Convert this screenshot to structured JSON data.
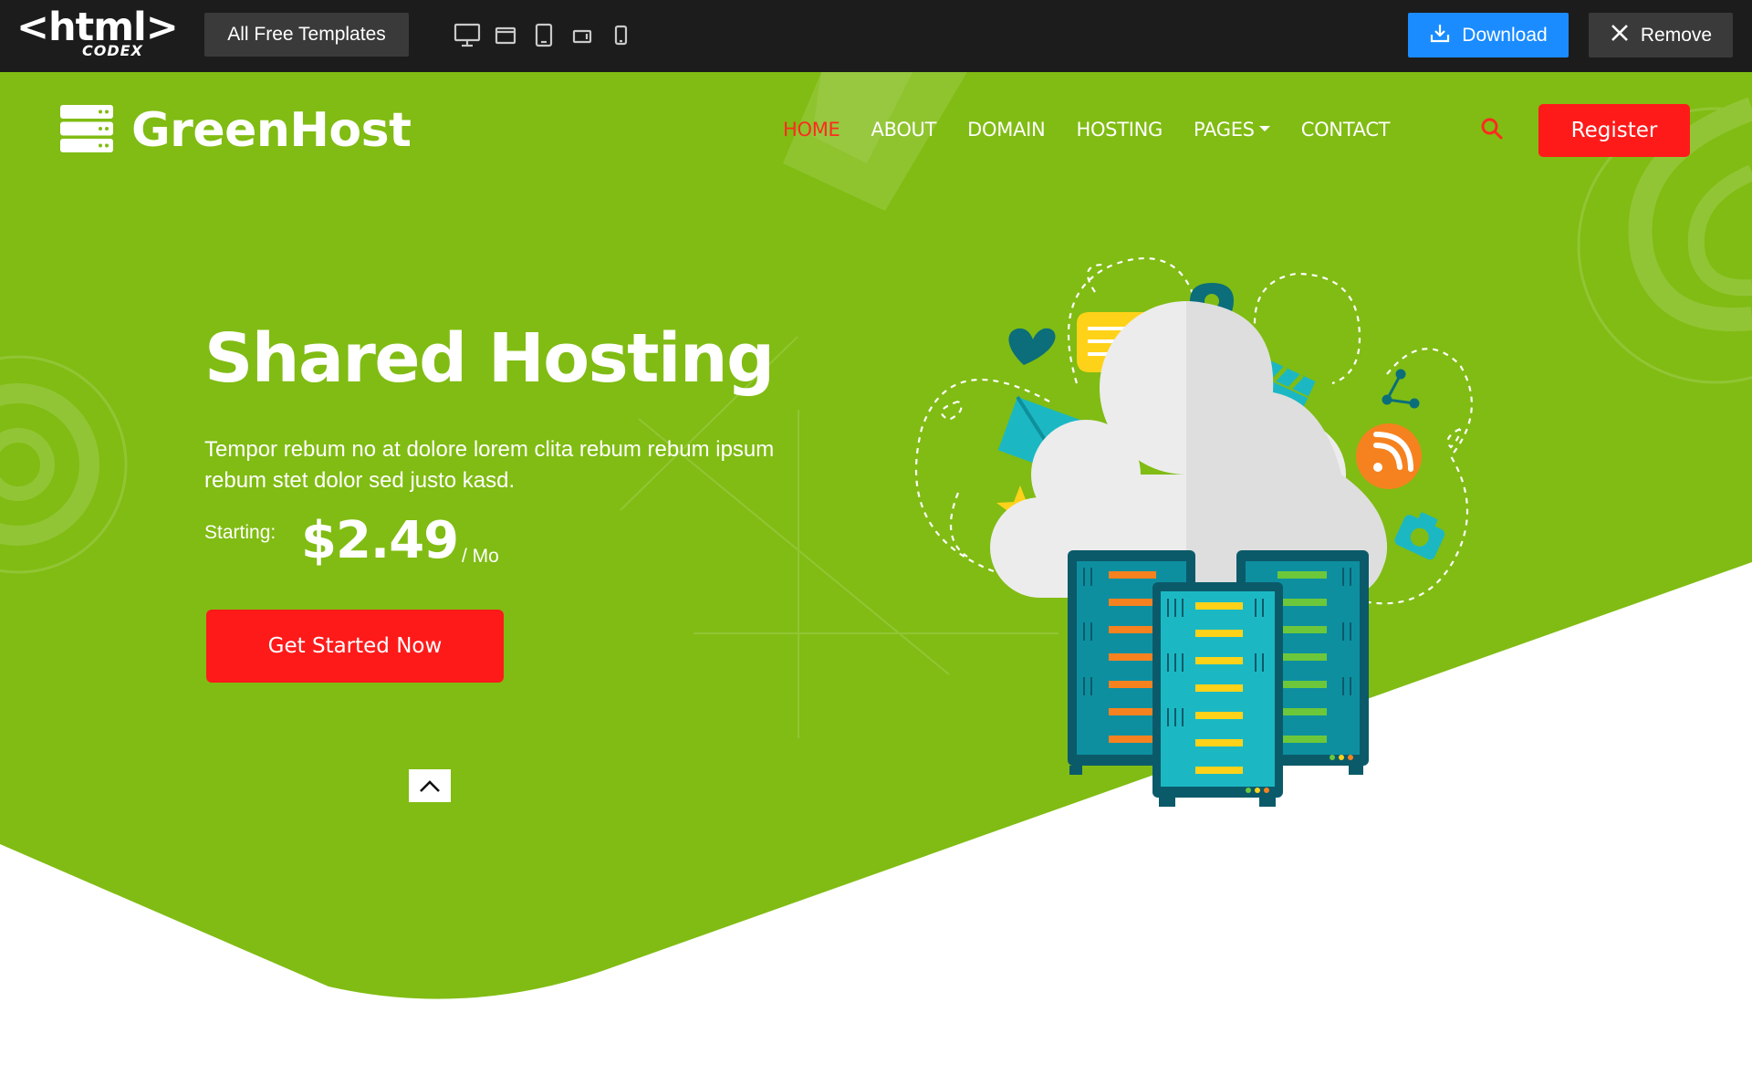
{
  "topbar": {
    "logo_main": "<html>",
    "logo_sub": "CODEX",
    "templates_label": "All Free Templates",
    "devices": [
      "desktop-icon",
      "laptop-icon",
      "tablet-icon",
      "tablet-landscape-icon",
      "mobile-icon"
    ],
    "download_label": "Download",
    "remove_label": "Remove"
  },
  "brand": {
    "name": "GreenHost",
    "icon": "server-stack-icon"
  },
  "nav": {
    "items": [
      {
        "label": "HOME",
        "active": true
      },
      {
        "label": "ABOUT"
      },
      {
        "label": "DOMAIN"
      },
      {
        "label": "HOSTING"
      },
      {
        "label": "PAGES"
      },
      {
        "label": "CONTACT"
      }
    ],
    "register_label": "Register"
  },
  "hero": {
    "title": "Shared Hosting",
    "text": "Tempor rebum no at dolore lorem clita rebum rebum ipsum rebum stet dolor sed justo kasd.",
    "starting_label": "Starting:",
    "price": "$2.49",
    "per": "/ Mo",
    "cta_label": "Get Started Now"
  },
  "colors": {
    "hero_green": "#80bc13",
    "accent_red": "#ff1a1a",
    "topbar_bg": "#1c1c1c",
    "download_blue": "#1a8cff"
  }
}
